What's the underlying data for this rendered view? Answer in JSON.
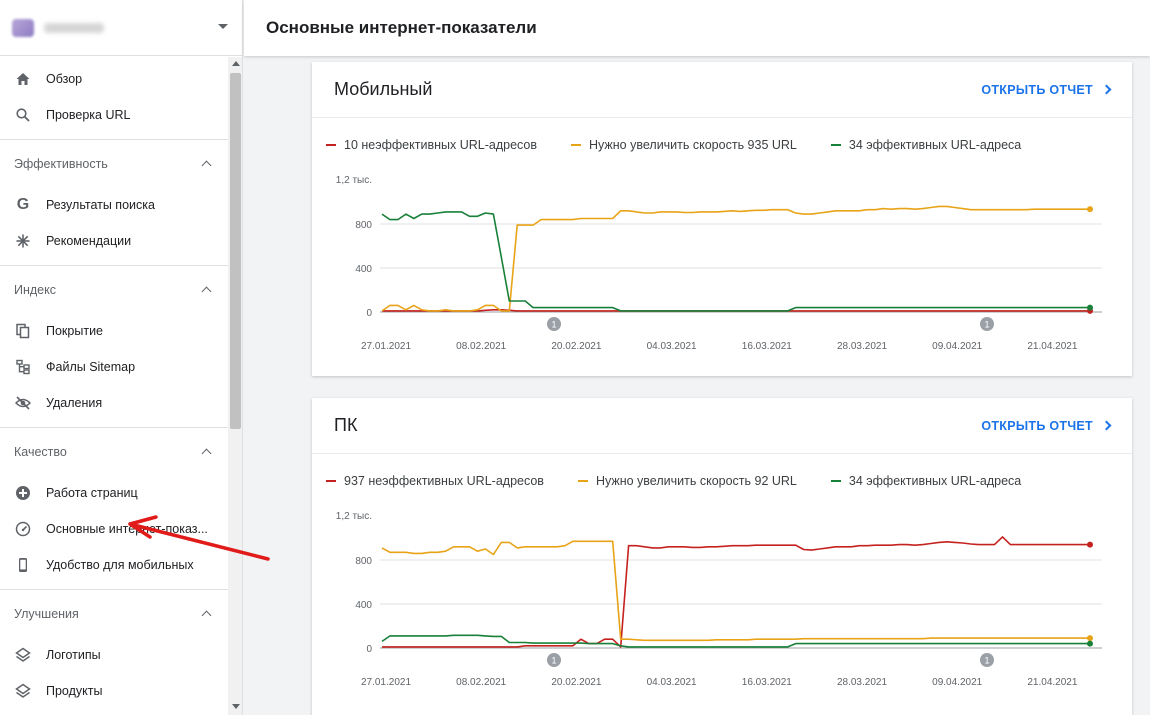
{
  "header": {
    "title": "Основные интернет-показатели"
  },
  "sidebar": {
    "items_top": [
      {
        "label": "Обзор",
        "icon": "home-icon"
      },
      {
        "label": "Проверка URL",
        "icon": "search-icon"
      }
    ],
    "sections": [
      {
        "title": "Эффективность",
        "items": [
          {
            "label": "Результаты поиска",
            "icon": "google-g-icon"
          },
          {
            "label": "Рекомендации",
            "icon": "asterisk-icon"
          }
        ]
      },
      {
        "title": "Индекс",
        "items": [
          {
            "label": "Покрытие",
            "icon": "copy-icon"
          },
          {
            "label": "Файлы Sitemap",
            "icon": "sitemap-icon"
          },
          {
            "label": "Удаления",
            "icon": "eye-off-icon"
          }
        ]
      },
      {
        "title": "Качество",
        "items": [
          {
            "label": "Работа страниц",
            "icon": "plus-circle-icon"
          },
          {
            "label": "Основные интернет-показ...",
            "icon": "gauge-icon"
          },
          {
            "label": "Удобство для мобильных",
            "icon": "phone-icon"
          }
        ]
      },
      {
        "title": "Улучшения",
        "items": [
          {
            "label": "Логотипы",
            "icon": "layers-icon"
          },
          {
            "label": "Продукты",
            "icon": "layers-icon"
          }
        ]
      }
    ]
  },
  "colors": {
    "poor": "#c5221f",
    "needs": "#e8a317",
    "good": "#188038",
    "link": "#1a73e8"
  },
  "cards": [
    {
      "title": "Мобильный",
      "open_report": "ОТКРЫТЬ ОТЧЕТ",
      "legend": [
        "10 неэффективных URL-адресов",
        "Нужно увеличить скорость 935 URL",
        "34 эффективных URL-адреса"
      ]
    },
    {
      "title": "ПК",
      "open_report": "ОТКРЫТЬ ОТЧЕТ",
      "legend": [
        "937 неэффективных URL-адресов",
        "Нужно увеличить скорость 92 URL",
        "34 эффективных URL-адреса"
      ]
    }
  ],
  "chart_data": [
    {
      "type": "line",
      "title": "Мобильный",
      "ymax_label": "1,2 тыс.",
      "yticks": [
        "0",
        "400",
        "800"
      ],
      "ylim": [
        0,
        1200
      ],
      "x_labels": [
        "27.01.2021",
        "08.02.2021",
        "20.02.2021",
        "04.03.2021",
        "16.03.2021",
        "28.03.2021",
        "09.04.2021",
        "21.04.2021"
      ],
      "annotations": [
        {
          "label": "1",
          "date": "20.02.2021"
        },
        {
          "label": "1",
          "date": "16.04.2021"
        }
      ],
      "series": [
        {
          "name": "10 неэффективных URL-адресов",
          "color": "#c5221f",
          "values": [
            10,
            10,
            10,
            10,
            10,
            10,
            10,
            10,
            10,
            10,
            10,
            10,
            10,
            15,
            20,
            20,
            15,
            10,
            10,
            10,
            10,
            10,
            10,
            10,
            10,
            10,
            10,
            10,
            10,
            10,
            10,
            10,
            10,
            10,
            10,
            10,
            10,
            10,
            10,
            10,
            10,
            10,
            10,
            10,
            10,
            10,
            10,
            10,
            10,
            10,
            10,
            10,
            10,
            10,
            10,
            10,
            10,
            10,
            10,
            10,
            10,
            10,
            10,
            10,
            10,
            10,
            10,
            10,
            10,
            10,
            10,
            10,
            10,
            10,
            10,
            10,
            10,
            10,
            10,
            10,
            10,
            10,
            10,
            10,
            10,
            10,
            10,
            10,
            10,
            10
          ]
        },
        {
          "name": "Нужно увеличить скорость 935 URL",
          "color": "#e8a317",
          "values": [
            10,
            60,
            60,
            20,
            60,
            20,
            10,
            10,
            20,
            10,
            10,
            10,
            20,
            60,
            60,
            10,
            10,
            790,
            790,
            790,
            840,
            840,
            840,
            840,
            840,
            850,
            850,
            850,
            850,
            850,
            920,
            920,
            910,
            900,
            900,
            910,
            910,
            910,
            905,
            905,
            910,
            910,
            910,
            915,
            920,
            915,
            920,
            925,
            925,
            930,
            930,
            930,
            900,
            890,
            890,
            900,
            910,
            920,
            920,
            920,
            920,
            930,
            930,
            940,
            935,
            940,
            940,
            935,
            940,
            950,
            960,
            960,
            950,
            940,
            930,
            930,
            930,
            930,
            930,
            930,
            930,
            930,
            935,
            935,
            935,
            935,
            935,
            935,
            935,
            935
          ]
        },
        {
          "name": "34 эффективных URL-адреса",
          "color": "#188038",
          "values": [
            890,
            840,
            840,
            890,
            850,
            890,
            890,
            900,
            910,
            910,
            910,
            870,
            870,
            900,
            890,
            500,
            100,
            100,
            100,
            40,
            40,
            40,
            40,
            40,
            40,
            40,
            40,
            40,
            40,
            40,
            10,
            10,
            10,
            10,
            10,
            10,
            10,
            10,
            10,
            10,
            10,
            10,
            10,
            10,
            10,
            10,
            10,
            10,
            10,
            10,
            10,
            10,
            40,
            40,
            40,
            40,
            40,
            40,
            40,
            40,
            40,
            40,
            40,
            40,
            40,
            40,
            40,
            40,
            40,
            40,
            40,
            40,
            40,
            40,
            40,
            40,
            40,
            40,
            40,
            40,
            40,
            40,
            40,
            40,
            40,
            40,
            40,
            40,
            40,
            40
          ]
        }
      ]
    },
    {
      "type": "line",
      "title": "ПК",
      "ymax_label": "1,2 тыс.",
      "yticks": [
        "0",
        "400",
        "800"
      ],
      "ylim": [
        0,
        1200
      ],
      "x_labels": [
        "27.01.2021",
        "08.02.2021",
        "20.02.2021",
        "04.03.2021",
        "16.03.2021",
        "28.03.2021",
        "09.04.2021",
        "21.04.2021"
      ],
      "annotations": [
        {
          "label": "1",
          "date": "20.02.2021"
        },
        {
          "label": "1",
          "date": "16.04.2021"
        }
      ],
      "series": [
        {
          "name": "937 неэффективных URL-адресов",
          "color": "#c5221f",
          "values": [
            10,
            10,
            10,
            10,
            10,
            10,
            10,
            10,
            10,
            10,
            10,
            10,
            10,
            10,
            10,
            10,
            10,
            10,
            20,
            20,
            20,
            20,
            20,
            20,
            20,
            80,
            40,
            40,
            80,
            80,
            10,
            930,
            930,
            920,
            910,
            910,
            920,
            920,
            920,
            915,
            915,
            920,
            920,
            925,
            930,
            930,
            930,
            935,
            935,
            935,
            935,
            935,
            935,
            895,
            890,
            900,
            910,
            920,
            920,
            920,
            930,
            930,
            935,
            935,
            935,
            940,
            940,
            935,
            940,
            950,
            960,
            965,
            960,
            955,
            945,
            940,
            940,
            940,
            1010,
            940,
            940,
            940,
            940,
            940,
            940,
            940,
            940,
            940,
            940,
            940
          ]
        },
        {
          "name": "Нужно увеличить скорость 92 URL",
          "color": "#e8a317",
          "values": [
            910,
            870,
            870,
            870,
            860,
            860,
            870,
            870,
            880,
            920,
            920,
            920,
            880,
            900,
            850,
            960,
            960,
            910,
            920,
            920,
            920,
            920,
            920,
            930,
            970,
            970,
            970,
            970,
            970,
            970,
            80,
            80,
            75,
            70,
            70,
            70,
            70,
            70,
            70,
            70,
            70,
            70,
            75,
            75,
            75,
            75,
            75,
            80,
            80,
            80,
            80,
            80,
            80,
            85,
            85,
            85,
            85,
            85,
            85,
            85,
            85,
            85,
            85,
            85,
            85,
            85,
            85,
            85,
            85,
            90,
            90,
            90,
            90,
            90,
            90,
            90,
            90,
            90,
            90,
            90,
            90,
            90,
            90,
            90,
            90,
            90,
            90,
            90,
            90,
            90
          ]
        },
        {
          "name": "34 эффективных URL-адреса",
          "color": "#188038",
          "values": [
            60,
            110,
            110,
            110,
            110,
            110,
            110,
            110,
            110,
            115,
            115,
            115,
            115,
            110,
            105,
            105,
            50,
            50,
            50,
            45,
            45,
            45,
            45,
            45,
            45,
            45,
            40,
            40,
            40,
            40,
            20,
            10,
            10,
            10,
            10,
            10,
            10,
            10,
            10,
            10,
            10,
            10,
            10,
            10,
            10,
            10,
            10,
            10,
            10,
            10,
            10,
            10,
            40,
            40,
            40,
            40,
            40,
            40,
            40,
            40,
            40,
            40,
            40,
            40,
            40,
            40,
            40,
            40,
            40,
            40,
            40,
            40,
            40,
            40,
            40,
            40,
            40,
            40,
            40,
            40,
            40,
            40,
            40,
            40,
            40,
            40,
            40,
            40,
            40,
            40
          ]
        }
      ]
    }
  ]
}
